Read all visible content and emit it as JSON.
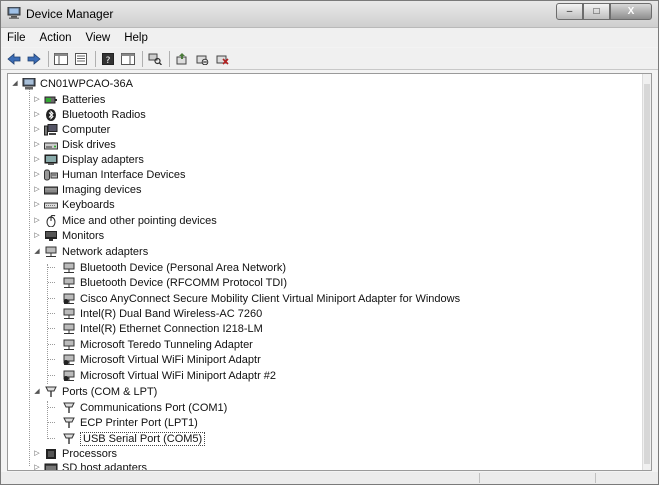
{
  "window": {
    "title": "Device Manager",
    "icon": "computer-icon",
    "minimize_icon": "minimize-icon",
    "maximize_icon": "maximize-icon",
    "close_icon": "close-icon",
    "minimize_glyph": "–",
    "maximize_glyph": "□",
    "close_glyph": "X"
  },
  "menubar": {
    "items": [
      "File",
      "Action",
      "View",
      "Help"
    ]
  },
  "toolbar": {
    "buttons": [
      "back-icon",
      "forward-icon",
      "show-hide-console-tree-icon",
      "properties-icon",
      "help-icon",
      "show-action-pane-icon",
      "scan-hardware-icon",
      "update-driver-icon",
      "disable-device-icon",
      "uninstall-device-icon"
    ]
  },
  "tree": {
    "root": "CN01WPCAO-36A",
    "categories": [
      "Batteries",
      "Bluetooth Radios",
      "Computer",
      "Disk drives",
      "Display adapters",
      "Human Interface Devices",
      "Imaging devices",
      "Keyboards",
      "Mice and other pointing devices",
      "Monitors",
      "Network adapters"
    ],
    "network_adapters": [
      "Bluetooth Device (Personal Area Network)",
      "Bluetooth Device (RFCOMM Protocol TDI)",
      "Cisco AnyConnect Secure Mobility Client Virtual Miniport Adapter for Windows",
      "Intel(R) Dual Band Wireless-AC 7260",
      "Intel(R) Ethernet Connection I218-LM",
      "Microsoft Teredo Tunneling Adapter",
      "Microsoft Virtual WiFi Miniport Adaptr",
      "Microsoft Virtual WiFi Miniport Adaptr #2"
    ],
    "ports_label": "Ports (COM & LPT)",
    "ports": [
      "Communications Port (COM1)",
      "ECP Printer Port (LPT1)",
      "USB Serial Port (COM5)"
    ],
    "after_ports": [
      "Processors",
      "SD host adapters"
    ],
    "selected": "USB Serial Port (COM5)"
  }
}
